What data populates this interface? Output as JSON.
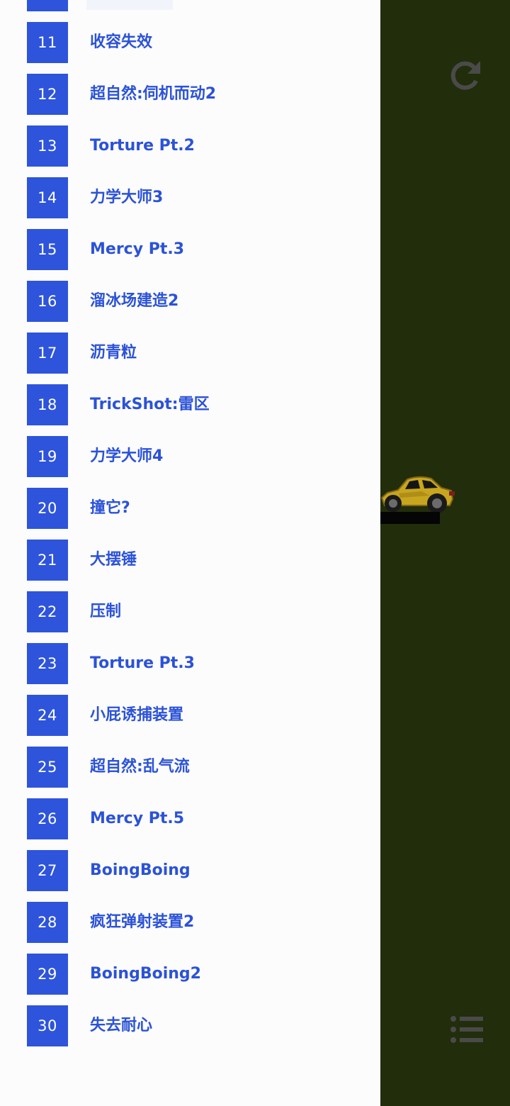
{
  "levels": [
    {
      "number": "11",
      "name": "收容失效"
    },
    {
      "number": "12",
      "name": "超自然:伺机而动2"
    },
    {
      "number": "13",
      "name": "Torture Pt.2"
    },
    {
      "number": "14",
      "name": "力学大师3"
    },
    {
      "number": "15",
      "name": "Mercy Pt.3"
    },
    {
      "number": "16",
      "name": "溜冰场建造2"
    },
    {
      "number": "17",
      "name": "沥青粒"
    },
    {
      "number": "18",
      "name": "TrickShot:雷区"
    },
    {
      "number": "19",
      "name": "力学大师4"
    },
    {
      "number": "20",
      "name": "撞它?"
    },
    {
      "number": "21",
      "name": "大摆锤"
    },
    {
      "number": "22",
      "name": "压制"
    },
    {
      "number": "23",
      "name": "Torture Pt.3"
    },
    {
      "number": "24",
      "name": "小屁诱捕装置"
    },
    {
      "number": "25",
      "name": "超自然:乱气流"
    },
    {
      "number": "26",
      "name": "Mercy Pt.5"
    },
    {
      "number": "27",
      "name": "BoingBoing"
    },
    {
      "number": "28",
      "name": "疯狂弹射装置2"
    },
    {
      "number": "29",
      "name": "BoingBoing2"
    },
    {
      "number": "30",
      "name": "失去耐心"
    }
  ],
  "icons": {
    "reload": "reload-icon",
    "menu": "list-menu-icon"
  },
  "colors": {
    "accent": "#2e54dc",
    "level_text": "#2b52d8",
    "game_background": "#222d0b",
    "drawer_background": "#fcfcfc",
    "icon_gray": "#4a4a4a"
  }
}
